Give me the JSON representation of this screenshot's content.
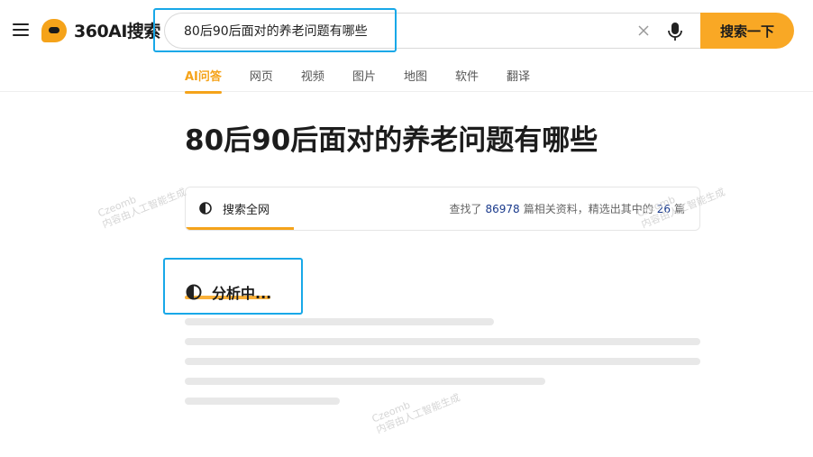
{
  "header": {
    "logo_text": "360AI搜索",
    "search": {
      "query": "80后90后面对的养老问题有哪些",
      "button_label": "搜索一下"
    },
    "tabs": [
      {
        "label": "AI问答"
      },
      {
        "label": "网页"
      },
      {
        "label": "视频"
      },
      {
        "label": "图片"
      },
      {
        "label": "地图"
      },
      {
        "label": "软件"
      },
      {
        "label": "翻译"
      }
    ],
    "active_tab": "AI问答"
  },
  "main": {
    "title": "80后90后面对的养老问题有哪些",
    "search_card": {
      "label": "搜索全网",
      "stats_prefix": "查找了",
      "total_count": "86978",
      "stats_middle": "篇相关资料，精选出其中的",
      "selected_count": "26",
      "stats_suffix": "篇",
      "progress": 0.21
    },
    "status": {
      "label": "分析中..."
    }
  },
  "watermark": {
    "line1": "Czeomb",
    "line2": "内容由人工智能生成"
  },
  "colors": {
    "accent": "#f9a825",
    "highlight_box": "#18a8e8",
    "number": "#1a3a8c",
    "skeleton": "#e8e8e8"
  }
}
